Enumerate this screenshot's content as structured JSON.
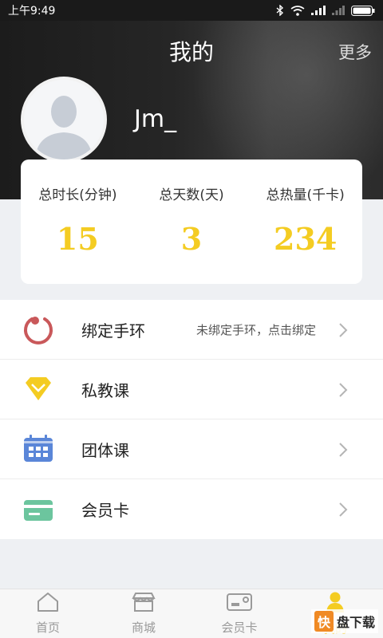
{
  "status_bar": {
    "time": "上午9:49"
  },
  "header": {
    "title": "我的",
    "more_label": "更多",
    "username": "Jm_"
  },
  "stats": [
    {
      "label": "总时长(分钟)",
      "value": "15"
    },
    {
      "label": "总天数(天)",
      "value": "3"
    },
    {
      "label": "总热量(千卡)",
      "value": "234"
    }
  ],
  "menu": [
    {
      "label": "绑定手环",
      "hint": "未绑定手环，点击绑定",
      "icon": "bracelet-icon",
      "color": "#c9585a"
    },
    {
      "label": "私教课",
      "hint": "",
      "icon": "diamond-icon",
      "color": "#f4cc22"
    },
    {
      "label": "团体课",
      "hint": "",
      "icon": "calendar-icon",
      "color": "#5a86d8"
    },
    {
      "label": "会员卡",
      "hint": "",
      "icon": "card-icon",
      "color": "#6cc59e"
    }
  ],
  "bottom_nav": [
    {
      "label": "首页",
      "icon": "home-icon",
      "active": false
    },
    {
      "label": "商城",
      "icon": "shop-icon",
      "active": false
    },
    {
      "label": "会员卡",
      "icon": "membership-card-icon",
      "active": false
    },
    {
      "label": "我的",
      "icon": "profile-icon",
      "active": true
    }
  ],
  "colors": {
    "accent": "#f4cc22",
    "header_bg": "#222222",
    "page_bg": "#eef0f3"
  },
  "watermark": {
    "mark": "快",
    "text": "盘下载"
  }
}
